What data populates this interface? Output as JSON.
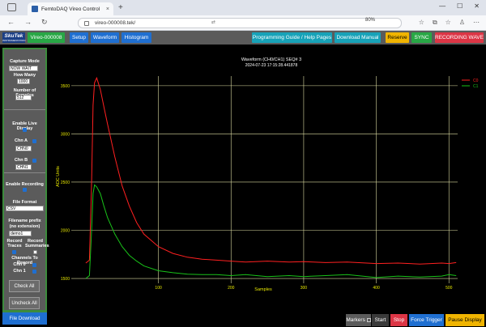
{
  "browser": {
    "tab_title": "FemtoDAQ Vireo Control",
    "tab_close": "×",
    "new_tab": "+",
    "url": "vireo-000008.tek/",
    "url_suffix": "⇄",
    "zoom": "80%",
    "nav": {
      "back": "←",
      "forward": "→",
      "reload": "↻"
    },
    "window": {
      "minimize": "—",
      "maximize": "☐",
      "close": "✕"
    },
    "toolbar_icons": {
      "star": "☆",
      "split": "⧉",
      "fav": "☆",
      "profile": "♙",
      "menu": "⋯"
    }
  },
  "header": {
    "logo": "SkuTek",
    "logo_sub": "INSTRUMENTATION",
    "device": "Vireo-000008",
    "setup": "Setup",
    "waveform": "Waveform",
    "histogram": "Histogram",
    "guide": "Programming Guide / Help Pages",
    "manual": "Download Manual",
    "reserve": "Reserve",
    "sync": "SYNC",
    "recording": "RECORDING WAVE",
    "colors": {
      "blue": "#1f6fd1",
      "teal": "#17a2b8",
      "yellow": "#f0b400",
      "green": "#28a745",
      "red": "#dc3545"
    }
  },
  "sidebar": {
    "capture_mode_label": "Capture Mode",
    "capture_mode_value": "NOW WAIT",
    "how_many_label": "How Many",
    "how_many_value": "1000",
    "num_samples_label": "Number of Samples",
    "num_samples_value": "512",
    "enable_live_label": "Enable Live Display",
    "chn_a_label": "Chn A",
    "chn_a_value": "CHN0",
    "chn_b_label": "Chn B",
    "chn_b_value": "CHN1",
    "enable_recording_label": "Enable Recording",
    "file_format_label": "File Format",
    "file_format_value": "CSV",
    "filename_label": "Filename prefix",
    "filename_sub": "(no extension)",
    "filename_value": "demo1",
    "record_traces_label": "Record Traces",
    "record_summaries_label": "Record Summaries",
    "channels_to_record_label": "Channels To Record",
    "chn0_label": "Chn 0",
    "chn1_label": "Chn 1",
    "check_all": "Check All",
    "uncheck_all": "Uncheck All",
    "file_download": "File Download"
  },
  "controls": {
    "markers": "Markers",
    "start": "Start",
    "stop": "Stop",
    "force_trigger": "Force Trigger",
    "pause_display": "Pause Display"
  },
  "chart_data": {
    "type": "line",
    "title": "Waveform (CH0/CH1) SEQ# 3",
    "subtitle": "2024-07-23 17:15:28.441878",
    "xlabel": "Samples",
    "ylabel": "ADC Units",
    "xlim": [
      -20,
      512
    ],
    "ylim": [
      1450,
      3650
    ],
    "x_ticks": [
      100,
      200,
      300,
      400,
      500
    ],
    "y_ticks": [
      1500,
      2000,
      2500,
      3000,
      3500
    ],
    "grid": true,
    "legend": "top-right",
    "series": [
      {
        "name": "C0",
        "color": "#ff2020",
        "x": [
          0,
          5,
          8,
          10,
          12,
          15,
          20,
          25,
          30,
          40,
          50,
          60,
          70,
          80,
          100,
          120,
          140,
          160,
          180,
          200,
          220,
          250,
          280,
          300,
          330,
          360,
          400,
          430,
          460,
          490,
          500,
          510
        ],
        "y": [
          1660,
          1690,
          2500,
          3300,
          3530,
          3580,
          3460,
          3280,
          3100,
          2760,
          2460,
          2250,
          2080,
          1960,
          1830,
          1760,
          1720,
          1700,
          1690,
          1680,
          1670,
          1680,
          1670,
          1675,
          1665,
          1670,
          1655,
          1660,
          1650,
          1660,
          1655,
          1665
        ]
      },
      {
        "name": "C1",
        "color": "#19c219",
        "x": [
          0,
          5,
          8,
          10,
          12,
          15,
          20,
          25,
          30,
          40,
          50,
          60,
          70,
          80,
          100,
          120,
          140,
          160,
          180,
          200,
          220,
          250,
          280,
          300,
          330,
          360,
          400,
          430,
          460,
          490,
          500,
          510
        ],
        "y": [
          1500,
          1530,
          2000,
          2380,
          2470,
          2450,
          2380,
          2250,
          2130,
          1960,
          1830,
          1740,
          1680,
          1630,
          1580,
          1560,
          1545,
          1540,
          1540,
          1530,
          1540,
          1520,
          1530,
          1520,
          1530,
          1540,
          1510,
          1525,
          1515,
          1525,
          1540,
          1530
        ]
      }
    ]
  }
}
